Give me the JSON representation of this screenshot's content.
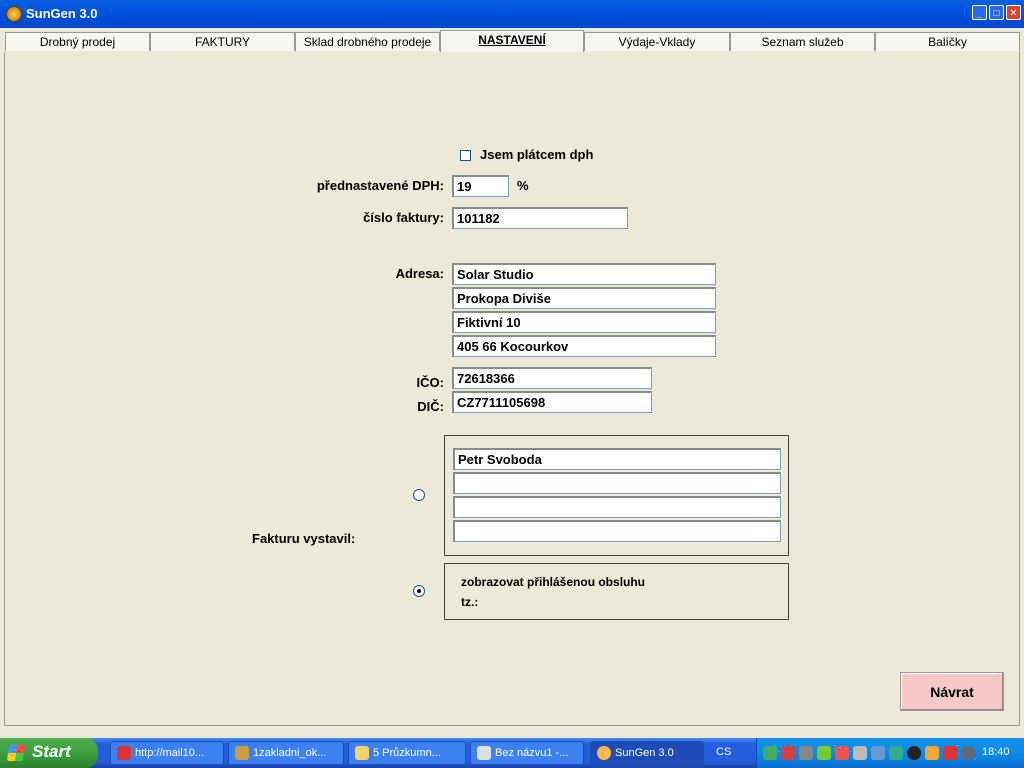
{
  "window": {
    "title": "SunGen 3.0",
    "min": "_",
    "max": "□",
    "close": "✕"
  },
  "tabs": [
    {
      "label": "Drobný prodej"
    },
    {
      "label": "FAKTURY"
    },
    {
      "label": "Sklad drobného prodeje"
    },
    {
      "label": "NASTAVENÍ"
    },
    {
      "label": "Výdaje-Vklady"
    },
    {
      "label": "Seznam služeb"
    },
    {
      "label": "Balíčky"
    }
  ],
  "settings": {
    "vat_payer_label": "Jsem plátcem dph",
    "vat_payer_checked": false,
    "default_vat_label": "přednastavené DPH:",
    "default_vat_value": "19",
    "vat_unit": "%",
    "invoice_no_label": "číslo faktury:",
    "invoice_no_value": "101182",
    "address_label": "Adresa:",
    "address_lines": [
      "Solar Studio",
      "Prokopa Diviše",
      "Fiktivní 10",
      "405 66 Kocourkov"
    ],
    "ico_label": "IČO:",
    "ico_value": "72618366",
    "dic_label": "DIČ:",
    "dic_value": "CZ7711105698",
    "issued_by_label": "Fakturu vystavil:",
    "issuer_lines": [
      "Petr Svoboda",
      "",
      "",
      ""
    ],
    "show_logged_label": "zobrazovat přihlášenou obsluhu",
    "tz_label": "tz.:",
    "selected_option": "show_logged"
  },
  "buttons": {
    "back": "Návrat"
  },
  "taskbar": {
    "start": "Start",
    "items": [
      {
        "label": "http://mail10..."
      },
      {
        "label": "1zakladni_ok..."
      },
      {
        "label": "5 Průzkumn..."
      },
      {
        "label": "Bez názvu1 -..."
      },
      {
        "label": "SunGen 3.0"
      }
    ],
    "lang": "CS",
    "clock": "18:40"
  }
}
